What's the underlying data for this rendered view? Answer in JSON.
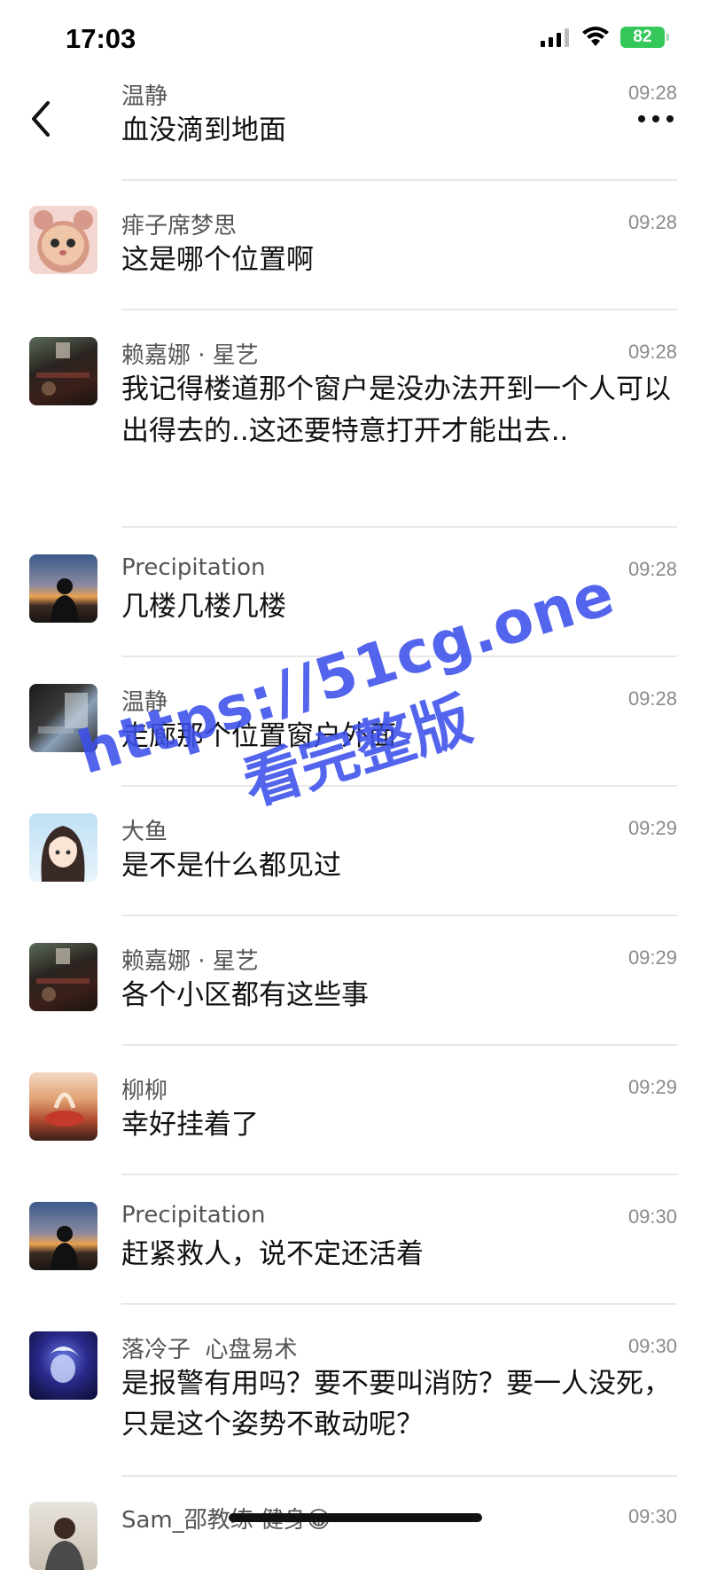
{
  "status_bar": {
    "time": "17:03",
    "battery": "82"
  },
  "header": {
    "name": "温静",
    "time": "09:28",
    "message": "血没滴到地面"
  },
  "comments": [
    {
      "name": "痱子席梦思",
      "time": "09:28",
      "message": "这是哪个位置啊",
      "avatar": "cat-avatar"
    },
    {
      "name": "赖嘉娜 · 星艺",
      "time": "09:28",
      "message": "我记得楼道那个窗户是没办法开到一个人可以出得去的..这还要特意打开才能出去..",
      "avatar": "dark-room-avatar"
    },
    {
      "name": "Precipitation",
      "time": "09:28",
      "message": "几楼几楼几楼",
      "avatar": "sunset-silhouette-avatar"
    },
    {
      "name": "温静",
      "time": "09:28",
      "message": "走廊那个位置窗户外面",
      "avatar": "dark-photo-avatar"
    },
    {
      "name": "大鱼",
      "time": "09:29",
      "message": "是不是什么都见过",
      "avatar": "anime-girl-avatar"
    },
    {
      "name": "赖嘉娜 · 星艺",
      "time": "09:29",
      "message": "各个小区都有这些事",
      "avatar": "dark-room-avatar"
    },
    {
      "name": "柳柳",
      "time": "09:29",
      "message": "幸好挂着了",
      "avatar": "warm-food-avatar"
    },
    {
      "name": "Precipitation",
      "time": "09:30",
      "message": "赶紧救人，说不定还活着",
      "avatar": "sunset-silhouette-avatar"
    },
    {
      "name": "落冷子  心盘易术",
      "time": "09:30",
      "message": "是报警有用吗？要不要叫消防？要一人没死，只是这个姿势不敢动呢？",
      "avatar": "blue-character-avatar"
    },
    {
      "name": "Sam_邵教练 健身😁",
      "time": "09:30",
      "message": "",
      "avatar": "man-portrait-avatar"
    }
  ],
  "watermark": {
    "url": "https://51cg.one",
    "subtitle": "看完整版"
  },
  "colors": {
    "accent_watermark": "#3c50eb",
    "battery": "#34c759",
    "divider": "#e8e8e8"
  }
}
